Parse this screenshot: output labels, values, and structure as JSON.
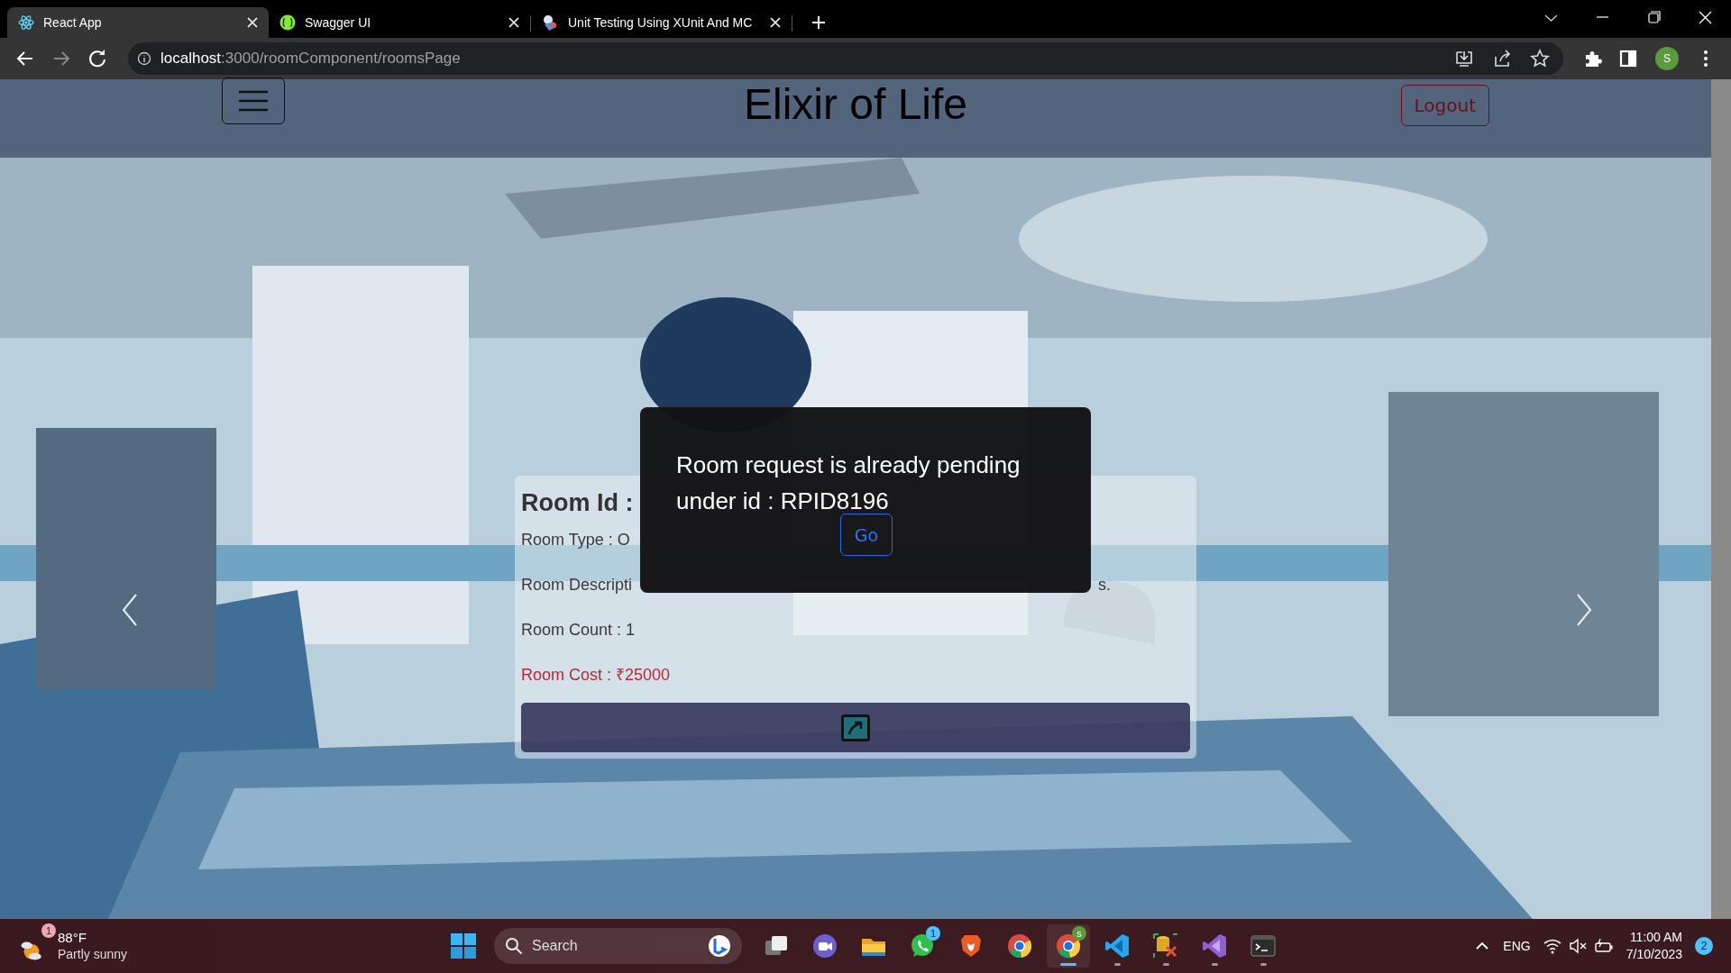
{
  "browser": {
    "tabs": [
      {
        "title": "React App",
        "kind": "react",
        "selected": true
      },
      {
        "title": "Swagger UI",
        "kind": "swagger",
        "selected": false
      },
      {
        "title": "Unit Testing Using XUnit And MC",
        "kind": "blog",
        "selected": false
      }
    ],
    "url": {
      "host": "localhost",
      "path": ":3000/roomComponent/roomsPage"
    },
    "profile": "S"
  },
  "header": {
    "title": "Elixir of Life",
    "logout": "Logout"
  },
  "card": {
    "room_id": "Room Id :",
    "room_type": "Room Type : O",
    "description": "Room Descripti",
    "description_tail": "s.",
    "count": "Room Count : 1",
    "cost": "Room Cost : ₹25000"
  },
  "modal": {
    "message": "Room request is already pending under id : RPID8196",
    "button": "Go"
  },
  "taskbar": {
    "weather": {
      "temperature": "88°F",
      "condition": "Partly sunny",
      "badge": "1"
    },
    "search": {
      "placeholder": "Search"
    },
    "apps": [
      {
        "kind": "taskview",
        "running": false,
        "selected": false
      },
      {
        "kind": "teams",
        "running": false,
        "selected": false
      },
      {
        "kind": "explorer",
        "running": false,
        "selected": false
      },
      {
        "kind": "whatsapp",
        "running": false,
        "selected": false,
        "badge": "1"
      },
      {
        "kind": "brave",
        "running": false,
        "selected": false
      },
      {
        "kind": "chrome",
        "running": false,
        "selected": false
      },
      {
        "kind": "chrome",
        "running": true,
        "selected": true,
        "badge": "s"
      },
      {
        "kind": "vscode",
        "running": true,
        "selected": false
      },
      {
        "kind": "tool",
        "running": true,
        "selected": false
      },
      {
        "kind": "vs",
        "running": true,
        "selected": false
      },
      {
        "kind": "terminal",
        "running": true,
        "selected": false
      }
    ],
    "language": "ENG",
    "time": "11:00 AM",
    "date": "7/10/2023",
    "notifications": "2"
  }
}
